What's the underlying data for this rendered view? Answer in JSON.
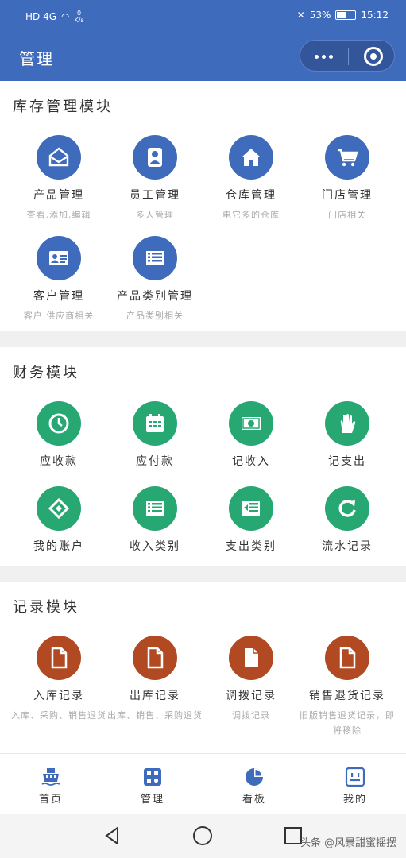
{
  "status_bar": {
    "left_indicators": "HD 4G",
    "net_speed_value": "0",
    "net_speed_unit": "K/s",
    "battery": "53%",
    "time": "15:12"
  },
  "header": {
    "title": "管理"
  },
  "inventory": {
    "title": "库存管理模块",
    "items": [
      {
        "label": "产品管理",
        "sub": "查看,添加,编辑"
      },
      {
        "label": "员工管理",
        "sub": "多人管理"
      },
      {
        "label": "仓库管理",
        "sub": "电它多的仓库"
      },
      {
        "label": "门店管理",
        "sub": "门店相关"
      },
      {
        "label": "客户管理",
        "sub": "客户,供应商相关"
      },
      {
        "label": "产品类别管理",
        "sub": "产品类别相关"
      }
    ]
  },
  "finance": {
    "title": "财务模块",
    "items": [
      {
        "label": "应收款"
      },
      {
        "label": "应付款"
      },
      {
        "label": "记收入"
      },
      {
        "label": "记支出"
      },
      {
        "label": "我的账户"
      },
      {
        "label": "收入类别"
      },
      {
        "label": "支出类别"
      },
      {
        "label": "流水记录"
      }
    ]
  },
  "records": {
    "title": "记录模块",
    "items": [
      {
        "label": "入库记录",
        "sub": "入库、采购、销售退货"
      },
      {
        "label": "出库记录",
        "sub": "出库、销售、采购退货"
      },
      {
        "label": "调拨记录",
        "sub": "调拨记录"
      },
      {
        "label": "销售退货记录",
        "sub": "旧版销售退货记录，即将移除"
      }
    ]
  },
  "tabbar": {
    "tabs": [
      {
        "label": "首页"
      },
      {
        "label": "管理"
      },
      {
        "label": "看板"
      },
      {
        "label": "我的"
      }
    ]
  },
  "watermark": "头条 @风景甜蜜摇摆",
  "colors": {
    "primary": "#3f6bbd",
    "finance": "#27a772",
    "records": "#b14a22"
  }
}
